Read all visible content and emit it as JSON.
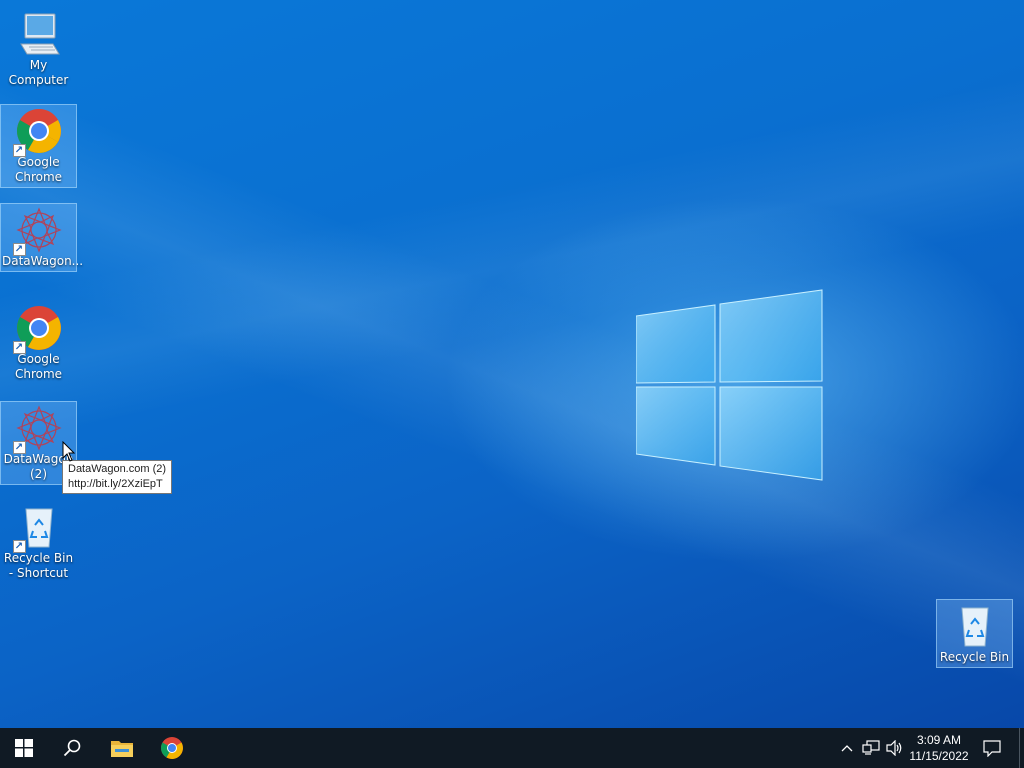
{
  "desktop": {
    "icons": [
      {
        "label": "My Computer",
        "icon": "computer-icon"
      },
      {
        "label": "Google Chrome",
        "icon": "chrome-icon"
      },
      {
        "label": "DataWagon...",
        "icon": "datawagon-icon"
      },
      {
        "label": "Google Chrome",
        "icon": "chrome-icon"
      },
      {
        "label": "DataWagon (2)",
        "icon": "datawagon-icon"
      },
      {
        "label": "Recycle Bin - Shortcut",
        "icon": "recycle-bin-icon"
      },
      {
        "label": "Recycle Bin",
        "icon": "recycle-bin-icon"
      }
    ],
    "tooltip": {
      "line1": "DataWagon.com (2)",
      "line2": "http://bit.ly/2XziEpT"
    }
  },
  "taskbar": {
    "buttons": [
      {
        "name": "start",
        "icon": "windows-icon"
      },
      {
        "name": "search",
        "icon": "search-icon"
      },
      {
        "name": "file-explorer",
        "icon": "folder-icon"
      },
      {
        "name": "chrome",
        "icon": "chrome-icon"
      }
    ],
    "tray_icons": [
      "chevron-up-icon",
      "network-icon",
      "volume-icon"
    ],
    "clock": {
      "time": "3:09 AM",
      "date": "11/15/2022"
    },
    "notification_icon": "action-center-icon"
  },
  "colors": {
    "desktop_blue": "#0a6fd0",
    "taskbar": "#101a24",
    "selection": "#8cc8ff"
  }
}
